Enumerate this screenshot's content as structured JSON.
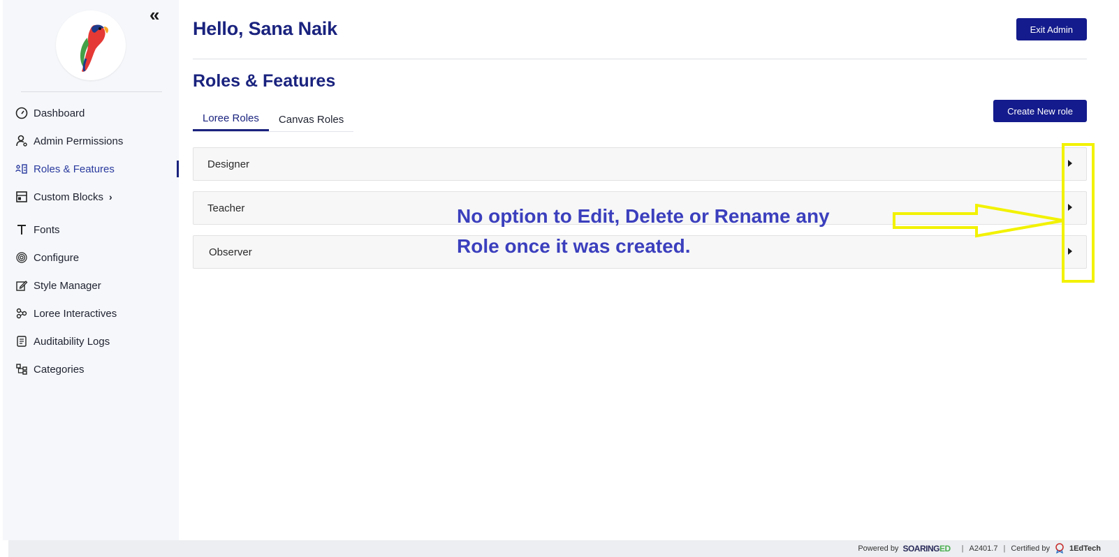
{
  "sidebar": {
    "collapse_glyph": "«",
    "items": [
      {
        "label": "Dashboard",
        "icon": "gauge-icon"
      },
      {
        "label": "Admin Permissions",
        "icon": "user-key-icon"
      },
      {
        "label": "Roles & Features",
        "icon": "roles-icon",
        "active": true
      },
      {
        "label": "Custom Blocks",
        "icon": "blocks-icon",
        "chevron": "›"
      },
      {
        "label": "Fonts",
        "icon": "font-icon"
      },
      {
        "label": "Configure",
        "icon": "fingerprint-icon"
      },
      {
        "label": "Style Manager",
        "icon": "edit-icon"
      },
      {
        "label": "Loree Interactives",
        "icon": "interactives-icon"
      },
      {
        "label": "Auditability Logs",
        "icon": "log-icon"
      },
      {
        "label": "Categories",
        "icon": "categories-icon"
      }
    ]
  },
  "header": {
    "greeting": "Hello, Sana Naik",
    "exit_label": "Exit Admin"
  },
  "page": {
    "title": "Roles & Features",
    "tabs": [
      {
        "label": "Loree Roles",
        "active": true
      },
      {
        "label": "Canvas Roles",
        "active": false
      }
    ],
    "create_label": "Create New role",
    "roles": [
      {
        "name": "Designer"
      },
      {
        "name": "Teacher"
      },
      {
        "name": "Observer"
      }
    ]
  },
  "annotation": {
    "line1": "No option to Edit, Delete or Rename any",
    "line2": "Role once it was created.",
    "color": "#3b3fbd",
    "highlight_color": "#f2f200"
  },
  "footer": {
    "powered_by": "Powered by",
    "brand_main": "SOARING",
    "brand_accent": "ED",
    "version": "A2401.7",
    "certified_by": "Certified by",
    "certifier": "1EdTech"
  },
  "colors": {
    "primary": "#141b8c",
    "heading": "#1a237e",
    "sidebar_bg": "#f5f7fa"
  }
}
